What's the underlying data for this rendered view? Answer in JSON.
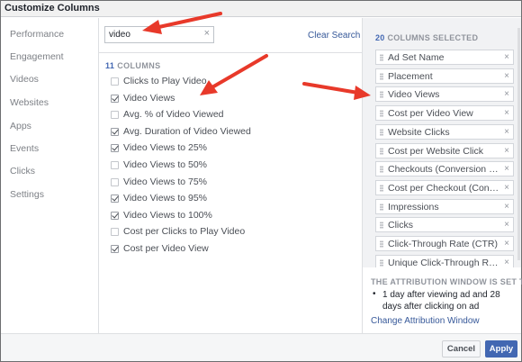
{
  "dialog": {
    "title": "Customize Columns"
  },
  "nav": {
    "items": [
      "Performance",
      "Engagement",
      "Videos",
      "Websites",
      "Apps",
      "Events",
      "Clicks",
      "Settings"
    ]
  },
  "search": {
    "value": "video",
    "clear_icon": "×",
    "clear_label": "Clear Search"
  },
  "columns": {
    "count": "11",
    "label": "COLUMNS",
    "items": [
      {
        "label": "Clicks to Play Video",
        "checked": false
      },
      {
        "label": "Video Views",
        "checked": true
      },
      {
        "label": "Avg. % of Video Viewed",
        "checked": false
      },
      {
        "label": "Avg. Duration of Video Viewed",
        "checked": true
      },
      {
        "label": "Video Views to 25%",
        "checked": true
      },
      {
        "label": "Video Views to 50%",
        "checked": false
      },
      {
        "label": "Video Views to 75%",
        "checked": false
      },
      {
        "label": "Video Views to 95%",
        "checked": true
      },
      {
        "label": "Video Views to 100%",
        "checked": true
      },
      {
        "label": "Cost per Clicks to Play Video",
        "checked": false
      },
      {
        "label": "Cost per Video View",
        "checked": true
      }
    ]
  },
  "selected": {
    "count": "20",
    "label": "COLUMNS SELECTED",
    "remove_icon": "×",
    "items": [
      "Ad Set Name",
      "Placement",
      "Video Views",
      "Cost per Video View",
      "Website Clicks",
      "Cost per Website Click",
      "Checkouts (Conversion Pixel)",
      "Cost per Checkout (Conversion Pixel)",
      "Impressions",
      "Clicks",
      "Click-Through Rate (CTR)",
      "Unique Click-Through Rate"
    ]
  },
  "attribution": {
    "title": "THE ATTRIBUTION WINDOW IS SET TO:",
    "bullet": "•",
    "text": "1 day after viewing ad and 28 days after clicking on ad",
    "link": "Change Attribution Window"
  },
  "footer": {
    "cancel_label": "Cancel",
    "apply_label": "Apply"
  },
  "colors": {
    "accent": "#4267b2",
    "link": "#365899",
    "annotation": "#e8392a"
  }
}
